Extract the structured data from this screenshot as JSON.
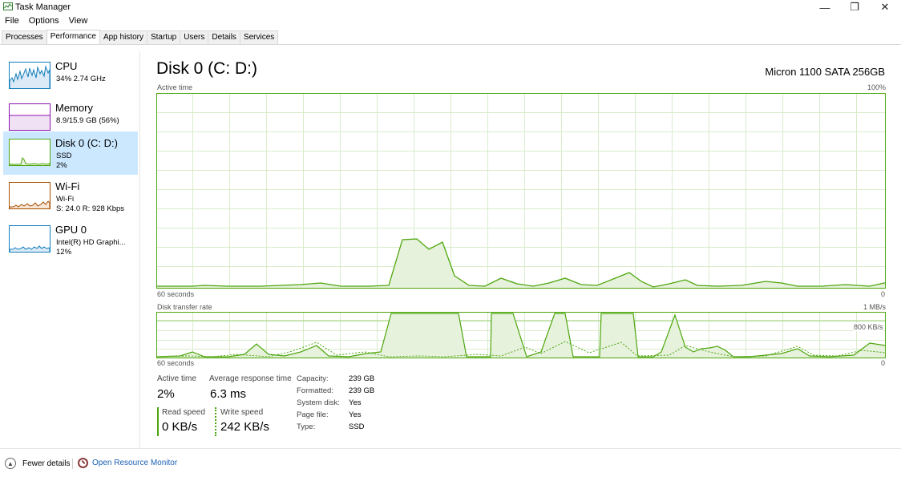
{
  "window": {
    "title": "Task Manager",
    "controls": {
      "minimize": "—",
      "maximize": "❐",
      "close": "✕"
    }
  },
  "menu": [
    "File",
    "Options",
    "View"
  ],
  "tabs": [
    {
      "label": "Processes",
      "active": false
    },
    {
      "label": "Performance",
      "active": true
    },
    {
      "label": "App history",
      "active": false
    },
    {
      "label": "Startup",
      "active": false
    },
    {
      "label": "Users",
      "active": false
    },
    {
      "label": "Details",
      "active": false
    },
    {
      "label": "Services",
      "active": false
    }
  ],
  "sidebar": {
    "items": [
      {
        "name": "CPU",
        "line2": "34% 2.74 GHz",
        "line3": "",
        "color": "#117dbb",
        "selected": false
      },
      {
        "name": "Memory",
        "line2": "8.9/15.9 GB (56%)",
        "line3": "",
        "color": "#8b12ae",
        "selected": false
      },
      {
        "name": "Disk 0 (C: D:)",
        "line2": "SSD",
        "line3": "2%",
        "color": "#4da60c",
        "selected": true
      },
      {
        "name": "Wi-Fi",
        "line2": "Wi-Fi",
        "line3": "S: 24.0 R: 928 Kbps",
        "color": "#a74f01",
        "selected": false
      },
      {
        "name": "GPU 0",
        "line2": "Intel(R) HD Graphi...",
        "line3": "12%",
        "color": "#117dbb",
        "selected": false
      }
    ]
  },
  "main": {
    "title": "Disk 0 (C: D:)",
    "model": "Micron 1100 SATA 256GB",
    "active_chart": {
      "label": "Active time",
      "max_label": "100%",
      "time_label": "60 seconds",
      "min_label": "0"
    },
    "transfer_chart": {
      "label": "Disk transfer rate",
      "max_label": "1 MB/s",
      "mid_label": "800 KB/s",
      "time_label": "60 seconds",
      "min_label": "0"
    },
    "stats": {
      "active_time_label": "Active time",
      "active_time": "2%",
      "response_label": "Average response time",
      "response": "6.3 ms",
      "read_label": "Read speed",
      "read": "0 KB/s",
      "write_label": "Write speed",
      "write": "242 KB/s"
    },
    "properties": [
      {
        "key": "Capacity:",
        "value": "239 GB"
      },
      {
        "key": "Formatted:",
        "value": "239 GB"
      },
      {
        "key": "System disk:",
        "value": "Yes"
      },
      {
        "key": "Page file:",
        "value": "Yes"
      },
      {
        "key": "Type:",
        "value": "SSD"
      }
    ]
  },
  "footer": {
    "fewer_details": "Fewer details",
    "resource_monitor": "Open Resource Monitor"
  },
  "colors": {
    "disk": "#4da60c",
    "grid": "#d9eccb",
    "selected_bg": "#cce8ff"
  }
}
